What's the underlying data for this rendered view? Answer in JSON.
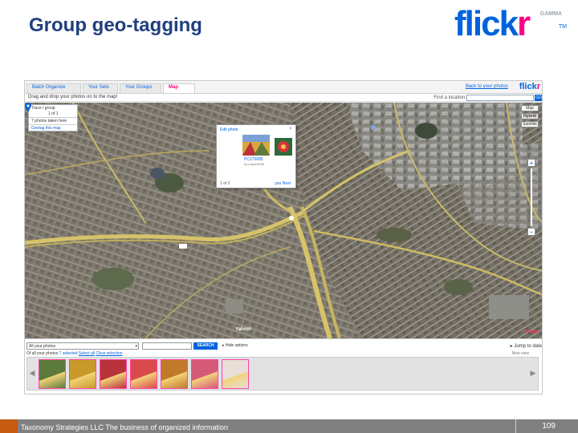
{
  "slide": {
    "title": "Group geo-tagging",
    "footer_text": "Taxonomy Strategies LLC  The business of organized information",
    "page_number": "109"
  },
  "logo": {
    "text_blue": "flick",
    "text_pink": "r",
    "beta": "GAMMA",
    "tm": "TM"
  },
  "app": {
    "tabs": [
      "Batch Organize",
      "Your Sets",
      "Your Groups",
      "Map"
    ],
    "active_tab": "Map",
    "back_link": "Back to your photos",
    "mini_logo_blue": "flick",
    "mini_logo_pink": "r",
    "drag_hint": "Drag and drop your photos on to the map!",
    "find_label": "Find a location:",
    "go_label": "GO",
    "left_panel": [
      "Trace / group",
      "1 of 1",
      "7 photos taken here",
      "Geotag this map"
    ],
    "map_types": [
      "Map",
      "Hybrid",
      "Satellite"
    ],
    "active_map_type": "Hybrid",
    "popup": {
      "edit": "Edit photo",
      "close": "×",
      "photo_id": "PC270085",
      "byline": "by pdpaulM/M",
      "prev": "1 of 2",
      "next": "you Next"
    },
    "map_logo": "Yahoo!",
    "map_copyright": "Yahoo!",
    "bottom": {
      "filter": "All your photos",
      "search_button": "SEARCH",
      "hide_option": "Hide options",
      "jump": "Jump to date",
      "row2_prefix": "Of all your photos ",
      "row2_selected": "7 selected",
      "row2_select_all": "Select all",
      "row2_clear": "Clear selection",
      "now_playing": "Now view"
    },
    "photo_colors": [
      "#5b7a3c",
      "#c89a2a",
      "#b8323a",
      "#d94a4a",
      "#c07a2a",
      "#d45a78",
      "#e8e0d8"
    ]
  }
}
